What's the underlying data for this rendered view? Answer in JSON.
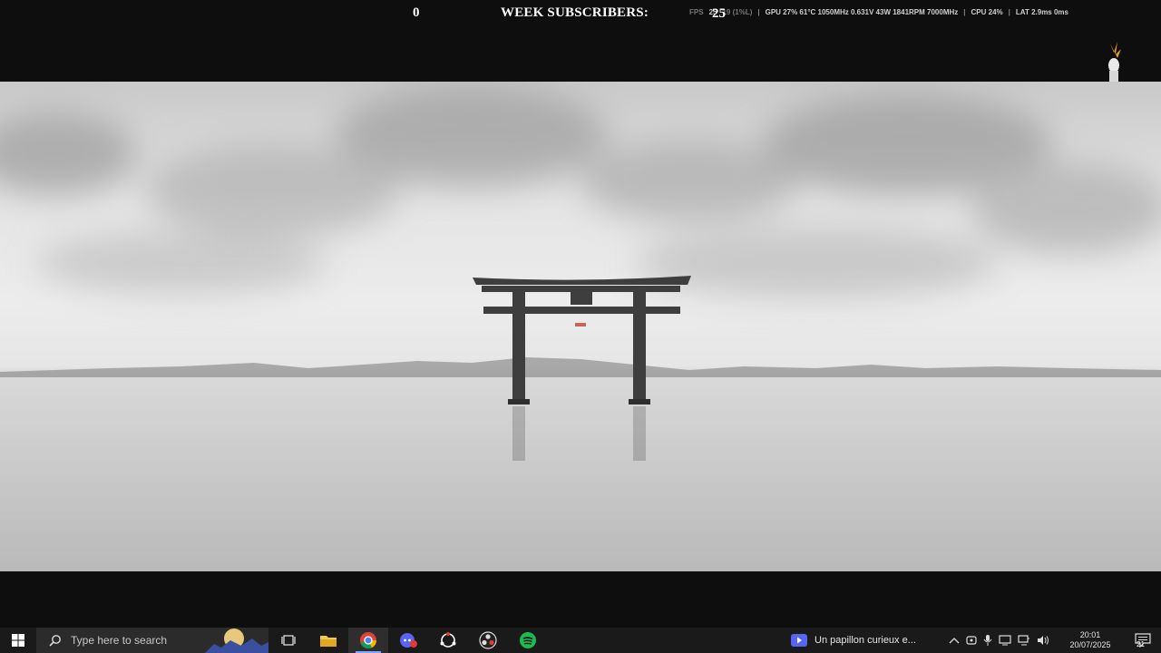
{
  "overlay": {
    "subscriber_count": "0",
    "subscriber_label": "WEEK SUBSCRIBERS:",
    "fps_big": "25",
    "perf": {
      "fps_label": "FPS",
      "fps_value": "25",
      "fps_low": "19 (1%L)",
      "gpu": "GPU 27% 61°C 1050MHz 0.631V 43W 1841RPM 7000MHz",
      "cpu": "CPU 24%",
      "lat": "LAT 2.9ms 0ms"
    }
  },
  "taskbar": {
    "search_placeholder": "Type here to search",
    "apps": [
      "task-view",
      "file-explorer",
      "chrome",
      "discord",
      "obs-helper",
      "obs",
      "spotify"
    ],
    "media_title": "Un papillon curieux e...",
    "clock_time": "20:01",
    "clock_date": "20/07/2025",
    "notification_count": "21"
  },
  "colors": {
    "taskbar_bg": "#1a1a1a",
    "accent": "#7aa7ff",
    "spotify": "#1db954"
  }
}
